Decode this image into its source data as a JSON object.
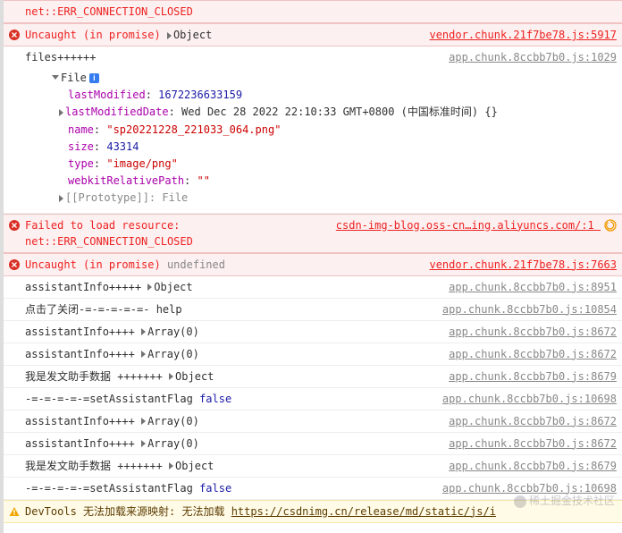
{
  "rows": [
    {
      "type": "error-cont",
      "left": "net::ERR_CONNECTION_CLOSED"
    },
    {
      "type": "error",
      "left_parts": [
        "Uncaught (in promise)"
      ],
      "expand": "Object",
      "src": "vendor.chunk.21f7be78.js:5917"
    },
    {
      "type": "log-header",
      "left": "files++++++",
      "src": "app.chunk.8ccbb7b0.js:1029"
    }
  ],
  "file_obj": {
    "header": "File",
    "props": [
      {
        "key": "lastModified",
        "val": "1672236633159",
        "val_class": "blue"
      },
      {
        "key": "lastModifiedDate",
        "val": "Wed Dec 28 2022 22:10:33 GMT+0800 (中国标准时间) {}",
        "val_class": "black",
        "tri": true
      },
      {
        "key": "name",
        "val": "\"sp20221228_221033_064.png\"",
        "val_class": "red"
      },
      {
        "key": "size",
        "val": "43314",
        "val_class": "blue"
      },
      {
        "key": "type",
        "val": "\"image/png\"",
        "val_class": "red"
      },
      {
        "key": "webkitRelativePath",
        "val": "\"\"",
        "val_class": "red"
      }
    ],
    "proto": "[[Prototype]]: File"
  },
  "rows2": [
    {
      "type": "error",
      "left_parts": [
        "Failed to load resource:",
        "net::ERR_CONNECTION_CLOSED"
      ],
      "src": "csdn-img-blog.oss-cn…ing.aliyuncs.com/:1",
      "reload": true
    },
    {
      "type": "error",
      "left_parts": [
        "Uncaught (in promise)"
      ],
      "undef": "undefined",
      "src": "vendor.chunk.21f7be78.js:7663"
    },
    {
      "type": "log",
      "left": "assistantInfo+++++",
      "expand": "Object",
      "src": "app.chunk.8ccbb7b0.js:8951"
    },
    {
      "type": "log",
      "left": "点击了关闭-=-=-=-=-=- help",
      "src": "app.chunk.8ccbb7b0.js:10854"
    },
    {
      "type": "log",
      "left": "assistantInfo++++",
      "expand": "Array(0)",
      "src": "app.chunk.8ccbb7b0.js:8672"
    },
    {
      "type": "log",
      "left": "assistantInfo++++",
      "expand": "Array(0)",
      "src": "app.chunk.8ccbb7b0.js:8672"
    },
    {
      "type": "log",
      "left": "我是发文助手数据 +++++++",
      "expand": "Object",
      "src": "app.chunk.8ccbb7b0.js:8679"
    },
    {
      "type": "log",
      "left": "-=-=-=-=-=setAssistantFlag ",
      "false": "false",
      "src": "app.chunk.8ccbb7b0.js:10698"
    },
    {
      "type": "log",
      "left": "assistantInfo++++",
      "expand": "Array(0)",
      "src": "app.chunk.8ccbb7b0.js:8672"
    },
    {
      "type": "log",
      "left": "assistantInfo++++",
      "expand": "Array(0)",
      "src": "app.chunk.8ccbb7b0.js:8672"
    },
    {
      "type": "log",
      "left": "我是发文助手数据 +++++++",
      "expand": "Object",
      "src": "app.chunk.8ccbb7b0.js:8679"
    },
    {
      "type": "log",
      "left": "-=-=-=-=-=setAssistantFlag ",
      "false": "false",
      "src": "app.chunk.8ccbb7b0.js:10698"
    }
  ],
  "warning": {
    "prefix": "DevTools 无法加载来源映射: 无法加载 ",
    "link": "https://csdnimg.cn/release/md/static/js/i"
  },
  "watermark": "稀土掘金技术社区"
}
